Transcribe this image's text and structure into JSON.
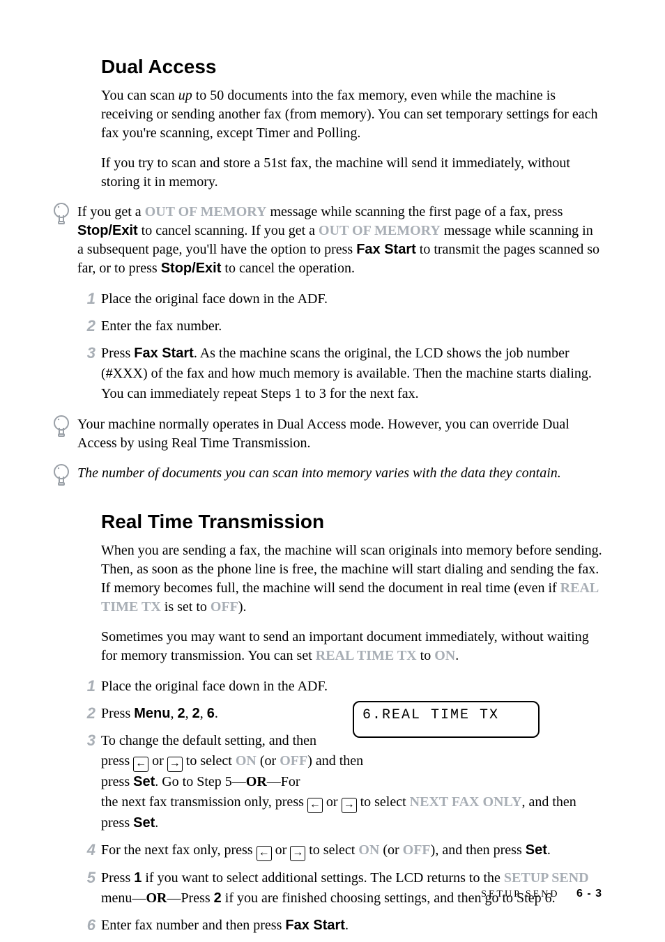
{
  "section1": {
    "heading": "Dual Access",
    "p1_a": "You can scan ",
    "p1_up": "up",
    "p1_b": " to 50 documents into the fax memory, even while the machine is receiving or sending another fax (from memory). You can set temporary settings for each fax you're scanning, except Timer and Polling.",
    "p2": "If you try to scan and store a 51st fax, the machine will send it immediately, without storing it in memory.",
    "note1_a": "If you get a ",
    "note1_oom": "OUT OF MEMORY",
    "note1_b": " message while scanning the first page of a fax, press ",
    "note1_stopexit": "Stop/Exit",
    "note1_c": " to cancel scanning.  If you get a ",
    "note1_d": " message while scanning in a subsequent page, you'll have the option to press ",
    "note1_faxstart": "Fax Start",
    "note1_e": " to transmit the pages scanned so far, or to press ",
    "note1_f": " to cancel the operation.",
    "steps": {
      "s1": "Place the original face down in the ADF.",
      "s2": "Enter the fax number.",
      "s3_a": "Press ",
      "s3_fs": "Fax Start",
      "s3_b": ". As the machine scans the original, the LCD shows the job number (#XXX) of the fax and how much memory is available. Then the machine starts dialing.  You can immediately repeat Steps 1 to 3 for the next fax."
    },
    "note2": "Your machine normally operates in Dual Access mode.  However, you can override Dual Access by using Real Time Transmission.",
    "note3": "The number of documents you can scan into memory varies with the data they contain."
  },
  "section2": {
    "heading": "Real Time Transmission",
    "p1_a": "When you are sending a fax, the machine will scan originals into memory before sending. Then, as soon as the phone line is free, the machine will start dialing and sending the fax. If memory becomes full, the machine will send the document in real time (even if ",
    "p1_rtt": "REAL TIME TX",
    "p1_b": " is set to ",
    "p1_off": "OFF",
    "p1_c": ").",
    "p2_a": "Sometimes you may want to send an important document immediately, without waiting for memory transmission. You can set ",
    "p2_b": " to ",
    "p2_on": "ON",
    "p2_c": ".",
    "steps": {
      "s1": "Place the original face down in the ADF.",
      "s2_a": "Press ",
      "s2_menu": "Menu",
      "s2_b": ", ",
      "s2_2a": "2",
      "s2_c": ", ",
      "s2_2b": "2",
      "s2_d": ", ",
      "s2_6": "6",
      "s2_e": ".",
      "s3_a": "To change the default setting, and then",
      "s3_b": "press ",
      "s3_c": " or ",
      "s3_d": " to select ",
      "s3_on": "ON",
      "s3_e": " (or ",
      "s3_off": "OFF",
      "s3_f": ") and then press ",
      "s3_set": "Set",
      "s3_g": ". Go to Step 5—",
      "s3_or": "OR",
      "s3_h": "—For",
      "s3_i": "the next fax transmission only, press ",
      "s3_j": " or ",
      "s3_k": " to select ",
      "s3_nfo": "NEXT FAX ONLY",
      "s3_l": ", and then press ",
      "s3_m": ".",
      "s4_a": "For the next fax only, press ",
      "s4_b": " or ",
      "s4_c": " to select ",
      "s4_d": " (or ",
      "s4_e": "), and then press ",
      "s4_f": ".",
      "s5_a": "Press ",
      "s5_1": "1",
      "s5_b": " if you want to select additional settings. The LCD returns to the ",
      "s5_ss": "SETUP SEND",
      "s5_c": " menu—",
      "s5_d": "—Press ",
      "s5_2": "2",
      "s5_e": " if you are finished choosing settings, and then go to Step 6.",
      "s6_a": "Enter fax number and then press ",
      "s6_b": "."
    },
    "lcd": "6.REAL TIME TX"
  },
  "nums": {
    "n1": "1",
    "n2": "2",
    "n3": "3",
    "n4": "4",
    "n5": "5",
    "n6": "6"
  },
  "arrows": {
    "left": "←",
    "right": "→"
  },
  "footer": {
    "section": "SETUP SEND",
    "page": "6 - 3"
  }
}
